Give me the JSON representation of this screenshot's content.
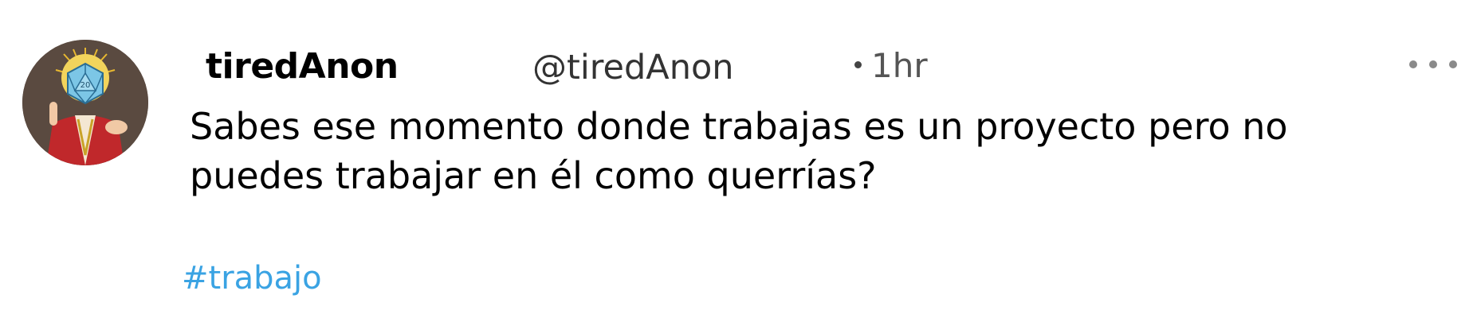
{
  "tweet": {
    "display_name": "tiredAnon",
    "handle": "@tiredAnon",
    "time": "1hr",
    "text_lines": [
      "Sabes ese momento donde trabajas es un proyecto pero no",
      "puedes trabajar en él como querrías?"
    ],
    "hashtag": "#trabajo",
    "avatar_icon": "d20-saint-avatar",
    "more_icon": "more-options-icon"
  },
  "colors": {
    "hashtag": "#3aa3e3",
    "handle": "#333333",
    "text": "#000000"
  }
}
